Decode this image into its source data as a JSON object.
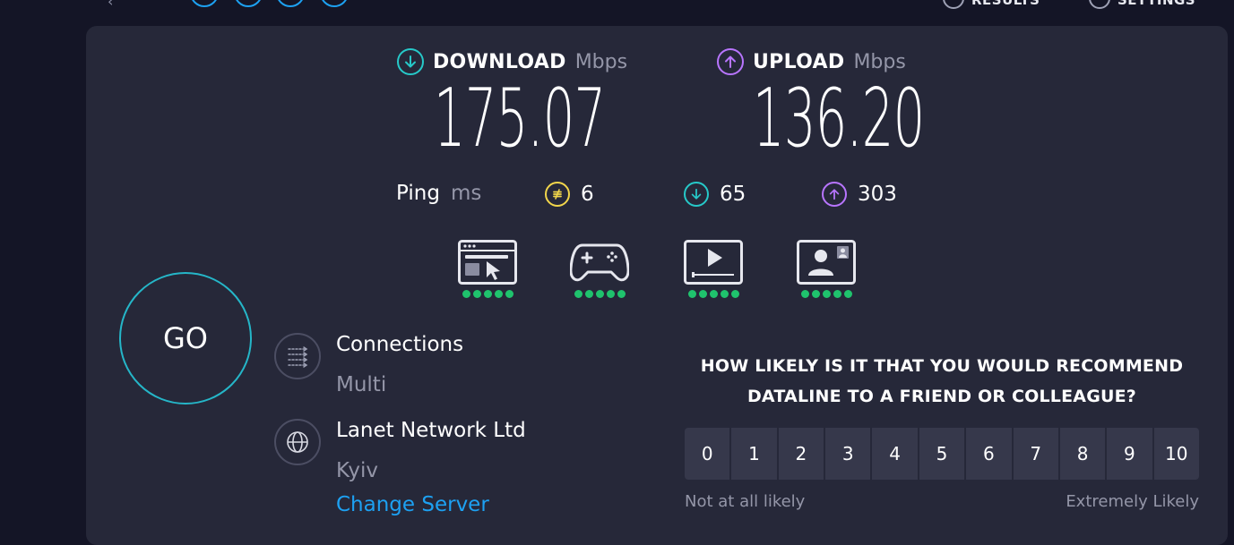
{
  "topbar": {
    "nav_results": "RESULTS",
    "nav_settings": "SETTINGS",
    "center_text": "· · ·"
  },
  "download": {
    "label": "DOWNLOAD",
    "unit": "Mbps",
    "value": "175.07",
    "color": "#26c9c9"
  },
  "upload": {
    "label": "UPLOAD",
    "unit": "Mbps",
    "value": "136.20",
    "color": "#b875ff"
  },
  "ping": {
    "label": "Ping",
    "unit": "ms",
    "idle": "6",
    "download": "65",
    "upload": "303",
    "idle_color": "#f2d64b"
  },
  "quality": [
    {
      "icon": "web-browsing-icon",
      "rating": 5
    },
    {
      "icon": "gaming-controller-icon",
      "rating": 5
    },
    {
      "icon": "video-streaming-icon",
      "rating": 5
    },
    {
      "icon": "video-call-icon",
      "rating": 5
    }
  ],
  "go_button": "GO",
  "connections": {
    "title": "Connections",
    "value": "Multi"
  },
  "server": {
    "name": "Lanet Network Ltd",
    "location": "Kyiv",
    "change_label": "Change Server"
  },
  "survey": {
    "question": "HOW LIKELY IS IT THAT YOU WOULD RECOMMEND DATALINE TO A FRIEND OR COLLEAGUE?",
    "options": [
      "0",
      "1",
      "2",
      "3",
      "4",
      "5",
      "6",
      "7",
      "8",
      "9",
      "10"
    ],
    "low_label": "Not at all likely",
    "high_label": "Extremely Likely"
  }
}
